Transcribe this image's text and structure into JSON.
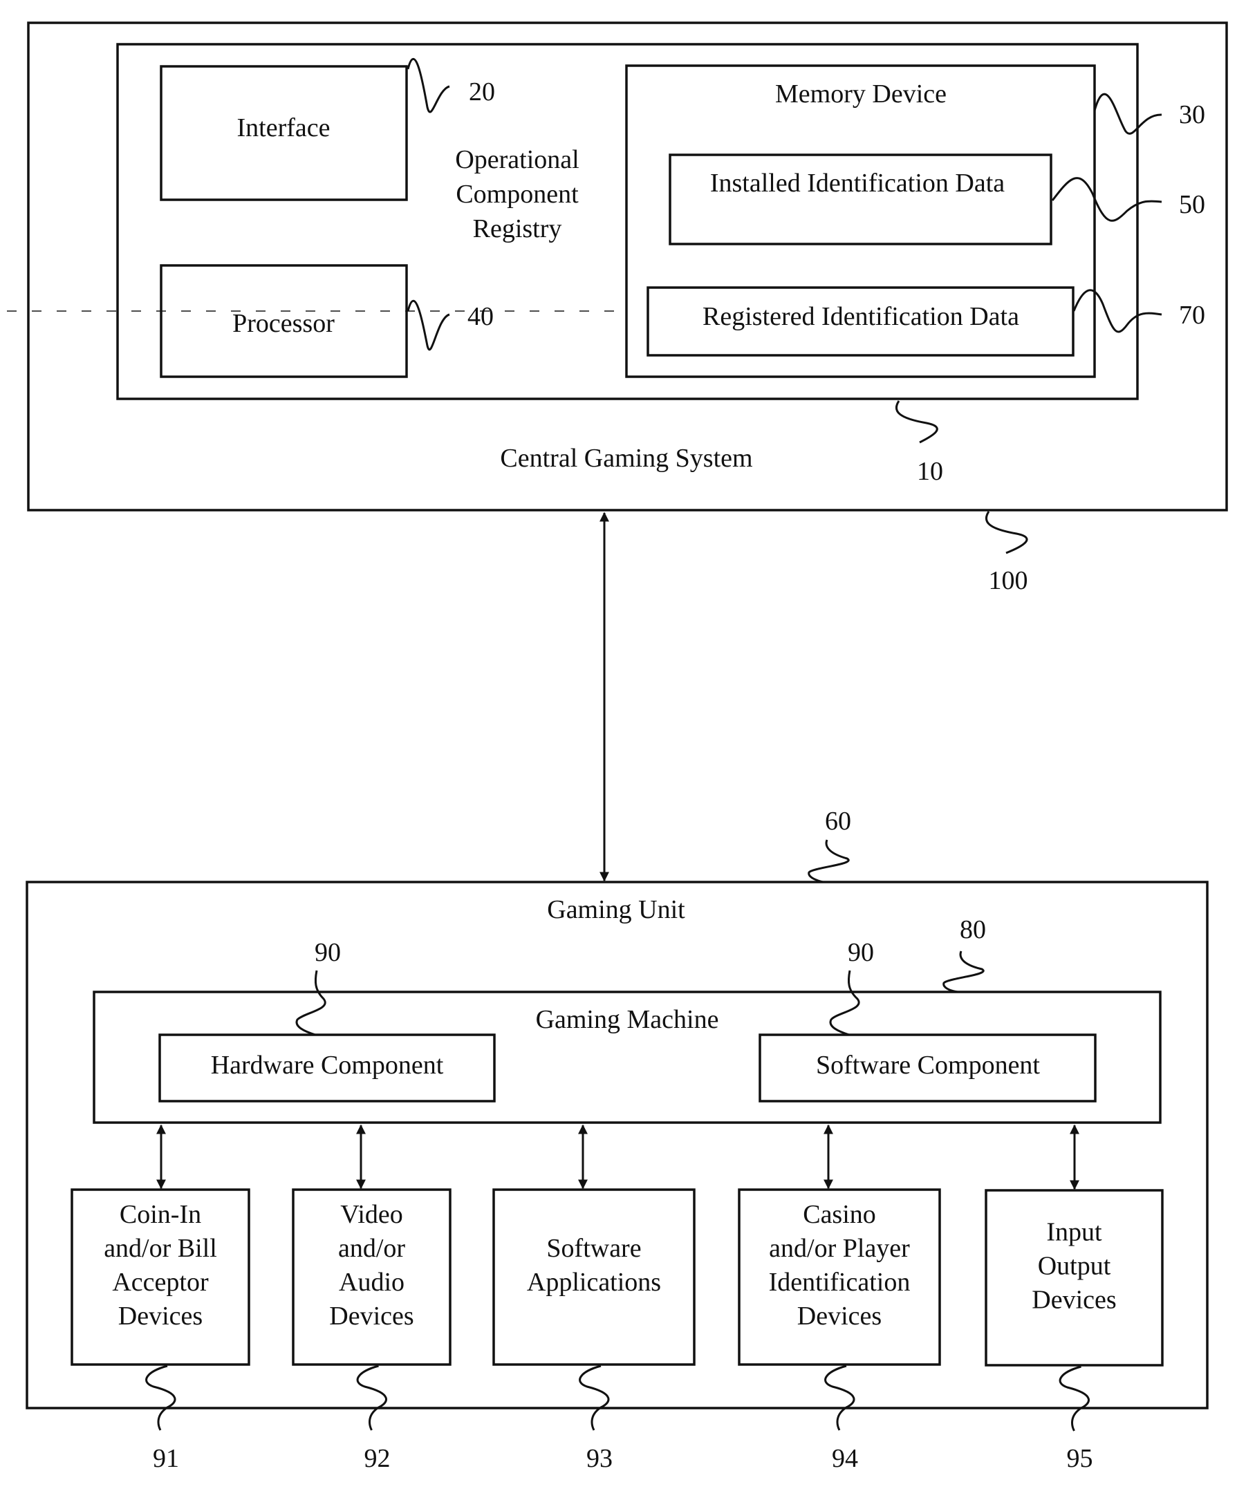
{
  "central_system": {
    "title": "Central Gaming System",
    "ref": "100",
    "registry": {
      "title_lines": [
        "Operational",
        "Component",
        "Registry"
      ],
      "ref": "10",
      "interface": {
        "label": "Interface",
        "ref": "20"
      },
      "processor": {
        "label": "Processor",
        "ref": "40"
      },
      "memory": {
        "label": "Memory Device",
        "ref": "30",
        "installed": {
          "label": "Installed Identification Data",
          "ref": "50"
        },
        "registered": {
          "label": "Registered Identification Data",
          "ref": "70"
        }
      }
    }
  },
  "gaming_unit": {
    "title": "Gaming Unit",
    "ref": "60",
    "machine": {
      "title": "Gaming Machine",
      "ref": "80",
      "hardware": {
        "label": "Hardware Component",
        "ref": "90"
      },
      "software": {
        "label": "Software Component",
        "ref": "90"
      }
    },
    "peripherals": [
      {
        "lines": [
          "Coin-In",
          "and/or Bill",
          "Acceptor",
          "Devices"
        ],
        "ref": "91"
      },
      {
        "lines": [
          "Video",
          "and/or",
          "Audio",
          "Devices"
        ],
        "ref": "92"
      },
      {
        "lines": [
          "Software",
          "Applications"
        ],
        "ref": "93"
      },
      {
        "lines": [
          "Casino",
          "and/or Player",
          "Identification",
          "Devices"
        ],
        "ref": "94"
      },
      {
        "lines": [
          "Input",
          "Output",
          "Devices"
        ],
        "ref": "95"
      }
    ]
  }
}
